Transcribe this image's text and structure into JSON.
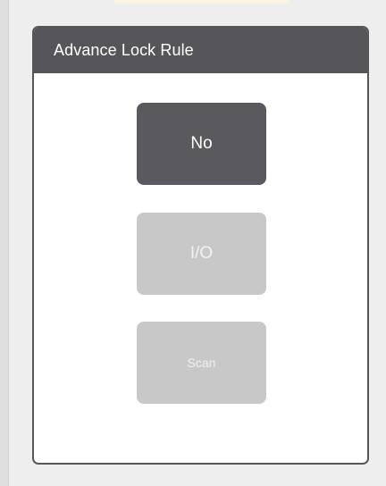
{
  "panel": {
    "title": "Advance Lock Rule"
  },
  "options": [
    {
      "label": "No",
      "state": "selected"
    },
    {
      "label": "I/O",
      "state": "disabled"
    },
    {
      "label": "Scan",
      "state": "disabled"
    }
  ],
  "colors": {
    "header": "#56565a",
    "selected": "#5a5a5e",
    "disabled": "#c8c8c8"
  }
}
